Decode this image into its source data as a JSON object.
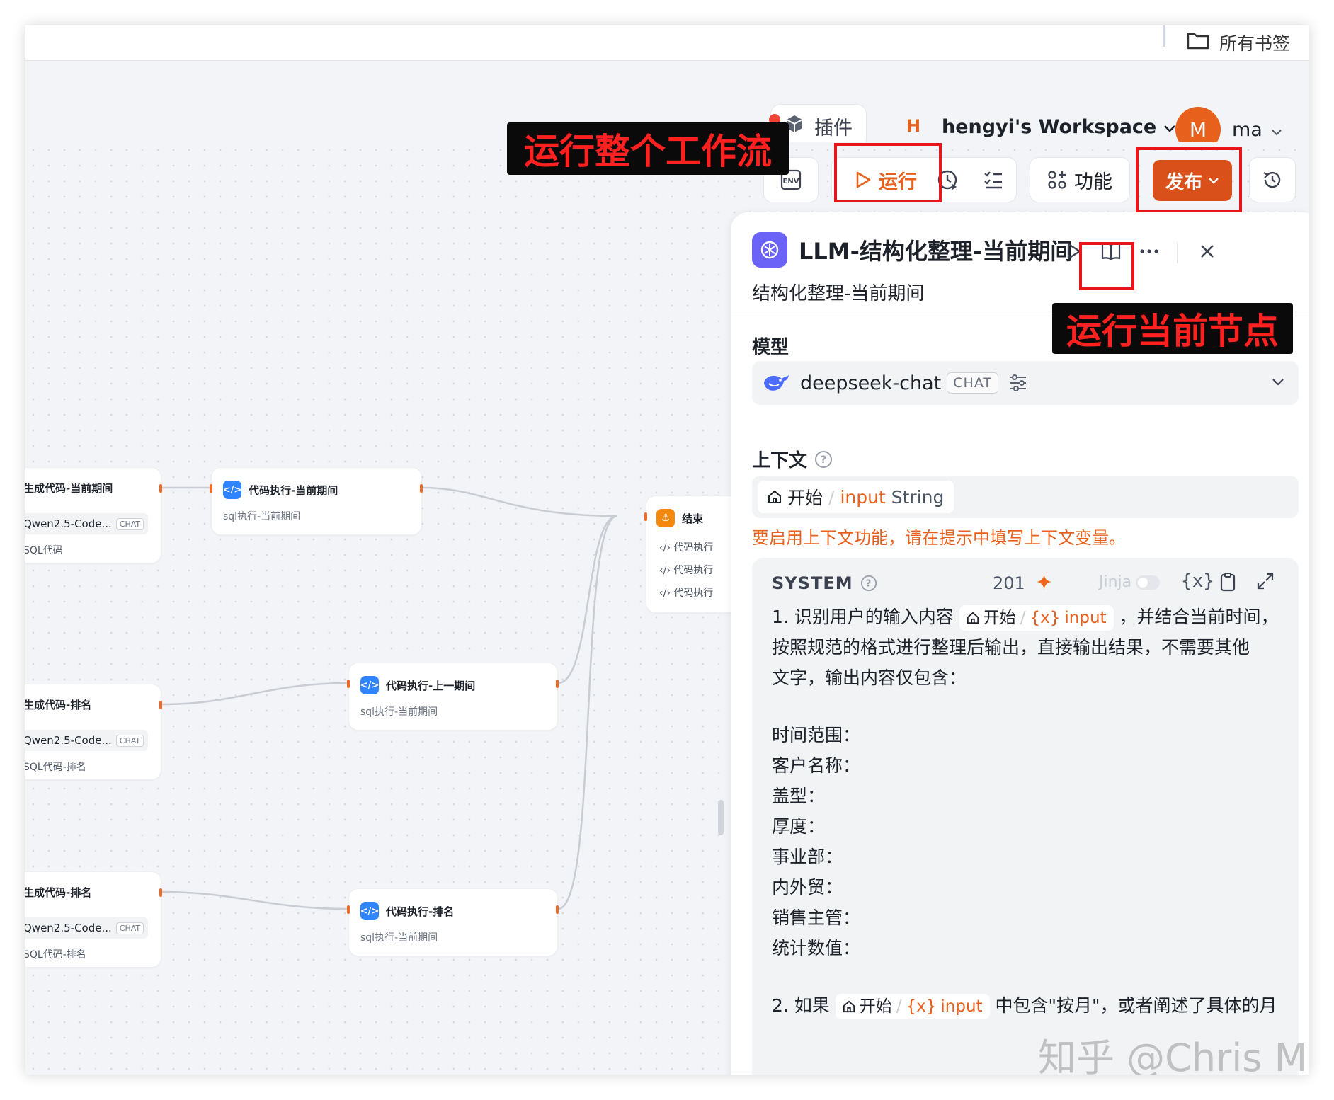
{
  "browser": {
    "bookmarks_label": "所有书签"
  },
  "header": {
    "plugin_label": "插件",
    "workspace_initial": "H",
    "workspace_name": "hengyi's Workspace",
    "avatar_initial": "M",
    "user_name": "ma"
  },
  "toolbar": {
    "env_label": "ENV",
    "run_label": "运行",
    "function_label": "功能",
    "publish_label": "发布"
  },
  "annotations": {
    "run_workflow": "运行整个工作流",
    "run_node": "运行当前节点"
  },
  "nodes": [
    {
      "id": "gen-current",
      "title": "生成代码-当前期间",
      "model": "Qwen2.5-Code...",
      "tag": "CHAT",
      "body": "SQL代码"
    },
    {
      "id": "exec-current",
      "title": "代码执行-当前期间",
      "subtitle": "sql执行-当前期间"
    },
    {
      "id": "end",
      "title": "结束",
      "rows": [
        "代码执行",
        "代码执行",
        "代码执行"
      ]
    },
    {
      "id": "gen-rank-1",
      "title": "生成代码-排名",
      "model": "Qwen2.5-Code...",
      "tag": "CHAT",
      "body": "SQL代码-排名"
    },
    {
      "id": "exec-prev",
      "title": "代码执行-上一期间",
      "subtitle": "sql执行-当前期间"
    },
    {
      "id": "gen-rank-2",
      "title": "生成代码-排名",
      "model": "Qwen2.5-Code...",
      "tag": "CHAT",
      "body": "SQL代码-排名"
    },
    {
      "id": "exec-rank",
      "title": "代码执行-排名",
      "subtitle": "sql执行-当前期间"
    }
  ],
  "panel": {
    "title": "LLM-结构化整理-当前期间",
    "description": "结构化整理-当前期间",
    "model_section": "模型",
    "model_name": "deepseek-chat",
    "model_tag": "CHAT",
    "context_section": "上下文",
    "context_chip": {
      "node": "开始",
      "var": "input",
      "type": "String"
    },
    "context_warning": "要启用上下文功能，请在提示中填写上下文变量。",
    "system": {
      "label": "SYSTEM",
      "count": "201",
      "jinja_label": "Jinja",
      "var_symbol": "{x}",
      "line1_prefix": "1. 识别用户的输入内容",
      "chip_node": "开始",
      "chip_var": "input",
      "line1_suffix": "，并结合当前时间，",
      "line2": "按照规范的格式进行整理后输出，直接输出结果，不需要其他",
      "line3": "文字，输出内容仅包含：",
      "fields": [
        "时间范围：",
        "客户名称：",
        "盖型：",
        "厚度：",
        "事业部：",
        "内外贸：",
        "销售主管：",
        "统计数值："
      ],
      "line_last_prefix": "2. 如果",
      "line_last_suffix": "中包含\"按月\"，或者阐述了具体的月"
    }
  },
  "watermark": "知乎 @Chris Ma"
}
